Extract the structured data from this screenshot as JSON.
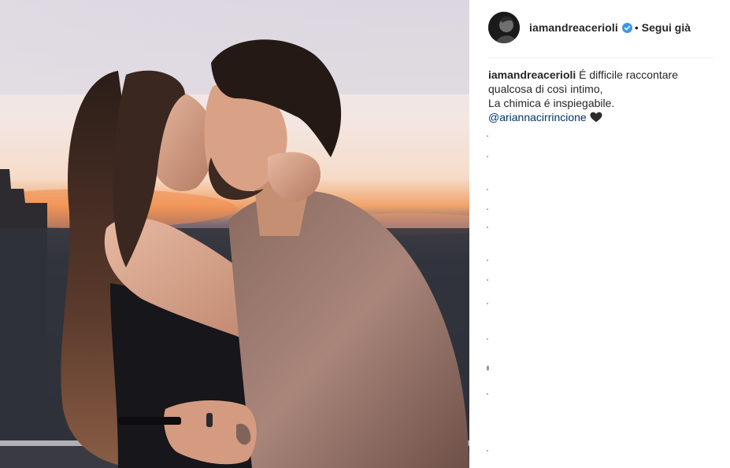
{
  "post": {
    "photo": {
      "description_icon": "photo-image"
    },
    "author": {
      "username": "iamandreacerioli",
      "verified": true,
      "separator": "•",
      "follow_label": "Segui già"
    },
    "caption": {
      "username": "iamandreacerioli",
      "line1_text": "É difficile raccontare",
      "line2": "qualcosa di così intimo,",
      "line3": "La chimica é inspiegabile.",
      "mention": "@ariannacirrincione",
      "emoji_icon": "black-heart-icon"
    }
  },
  "colors": {
    "text_primary": "#262626",
    "mention": "#003569",
    "verified_blue": "#3897f0",
    "divider": "#efefef"
  }
}
